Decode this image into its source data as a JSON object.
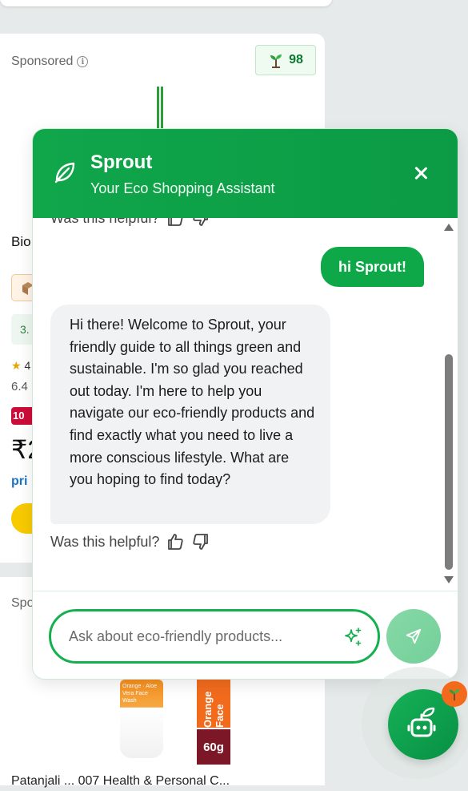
{
  "background": {
    "card1": {
      "sponsored": "Sponsored",
      "eco_score": "98",
      "title_clip": "Bio",
      "variant_clip": "3.",
      "rating_clip": "4",
      "reviews_clip": "6.4",
      "discount_clip": "10",
      "price_clip": "₹2",
      "prime_clip": "pri"
    },
    "card2": {
      "sponsored": "Spo",
      "tube_label": "Orange · Aloe Vera Face Wash",
      "box_label": "Orange Face",
      "box_weight": "60g",
      "title_clip": "Patanjali ... 007 Health & Personal C..."
    }
  },
  "chat": {
    "title": "Sprout",
    "subtitle": "Your Eco Shopping Assistant",
    "messages": {
      "prev_feedback": "Was this helpful?",
      "user": "hi Sprout!",
      "bot": "Hi there! Welcome to Sprout, your friendly guide to all things green and sustainable. I'm so glad you reached out today. I'm here to help you navigate our eco-friendly products and find exactly what you need to live a more conscious lifestyle. What are you hoping to find today?",
      "feedback": "Was this helpful?"
    },
    "input": {
      "placeholder": "Ask about eco-friendly products...",
      "value": ""
    },
    "colors": {
      "brand_green": "#0ea848",
      "send_green": "#7ed4a0",
      "badge_orange": "#f46a1d"
    }
  }
}
